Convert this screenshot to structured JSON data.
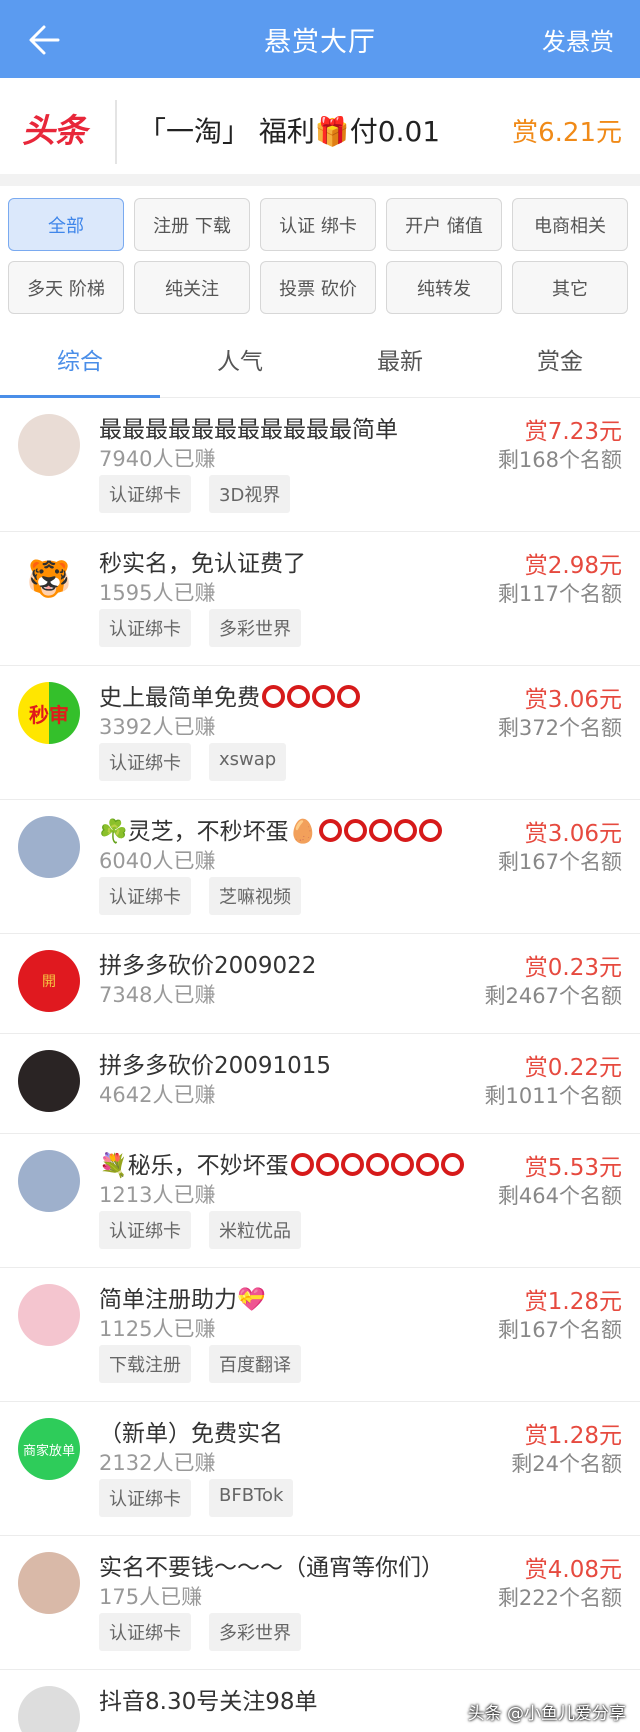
{
  "header": {
    "title": "悬赏大厅",
    "publish_label": "发悬赏"
  },
  "banner": {
    "logo": "头条",
    "text": "「一淘」 福利🎁付0.01",
    "reward": "赏6.21元"
  },
  "filters": [
    "全部",
    "注册 下载",
    "认证 绑卡",
    "开户 储值",
    "电商相关",
    "多天 阶梯",
    "纯关注",
    "投票 砍价",
    "纯转发",
    "其它"
  ],
  "tabs": [
    "综合",
    "人气",
    "最新",
    "赏金"
  ],
  "tasks": [
    {
      "title": "最最最最最最最最最最最简单",
      "earned": "7940人已赚",
      "tags": [
        "认证绑卡",
        "3D视界"
      ],
      "reward": "赏7.23元",
      "remain": "剩168个名额",
      "avatar_text": "",
      "avatar_color": "#e9dcd5"
    },
    {
      "title": "秒实名，免认证费了",
      "earned": "1595人已赚",
      "tags": [
        "认证绑卡",
        "多彩世界"
      ],
      "reward": "赏2.98元",
      "remain": "剩117个名额",
      "avatar_text": "🐯",
      "avatar_color": "#ffffff"
    },
    {
      "title": "史上最简单免费",
      "circles": 4,
      "earned": "3392人已赚",
      "tags": [
        "认证绑卡",
        "xswap"
      ],
      "reward": "赏3.06元",
      "remain": "剩372个名额",
      "avatar_text": "秒审",
      "avatar_color": "#ffe600"
    },
    {
      "title": "☘️灵芝，不秒坏蛋🥚",
      "circles": 5,
      "earned": "6040人已赚",
      "tags": [
        "认证绑卡",
        "芝嘛视频"
      ],
      "reward": "赏3.06元",
      "remain": "剩167个名额",
      "avatar_text": "",
      "avatar_color": "#9eb0cc"
    },
    {
      "title": "拼多多砍价2009022",
      "earned": "7348人已赚",
      "tags": [],
      "reward": "赏0.23元",
      "remain": "剩2467个名额",
      "avatar_text": "開",
      "avatar_color": "#e0191f"
    },
    {
      "title": "拼多多砍价20091015",
      "earned": "4642人已赚",
      "tags": [],
      "reward": "赏0.22元",
      "remain": "剩1011个名额",
      "avatar_text": "",
      "avatar_color": "#2a2424"
    },
    {
      "title": "💐秘乐，不妙坏蛋",
      "circles": 7,
      "earned": "1213人已赚",
      "tags": [
        "认证绑卡",
        "米粒优品"
      ],
      "reward": "赏5.53元",
      "remain": "剩464个名额",
      "avatar_text": "",
      "avatar_color": "#9eb0cc"
    },
    {
      "title": "简单注册助力💝",
      "earned": "1125人已赚",
      "tags": [
        "下载注册",
        "百度翻译"
      ],
      "reward": "赏1.28元",
      "remain": "剩167个名额",
      "avatar_text": "",
      "avatar_color": "#f4c5cf"
    },
    {
      "title": "（新单）免费实名",
      "earned": "2132人已赚",
      "tags": [
        "认证绑卡",
        "BFBTok"
      ],
      "reward": "赏1.28元",
      "remain": "剩24个名额",
      "avatar_text": "商家放单",
      "avatar_color": "#2ecc5a"
    },
    {
      "title": "实名不要钱～～～（通宵等你们）",
      "earned": "175人已赚",
      "tags": [
        "认证绑卡",
        "多彩世界"
      ],
      "reward": "赏4.08元",
      "remain": "剩222个名额",
      "avatar_text": "",
      "avatar_color": "#d9b9a8"
    },
    {
      "title": "抖音8.30号关注98单",
      "earned": "",
      "tags": [],
      "reward": "",
      "remain": "",
      "avatar_text": "",
      "avatar_color": "#dddddd"
    }
  ],
  "watermark": "头条 @小鱼儿爱分享"
}
